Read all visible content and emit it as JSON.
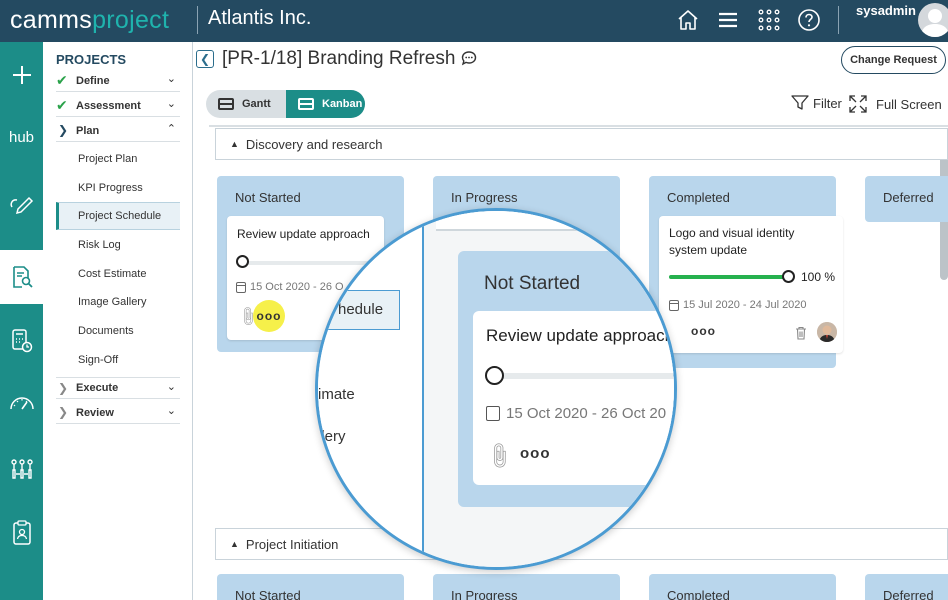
{
  "header": {
    "logo_part1": "camms",
    "logo_part2": "project",
    "company": "Atlantis Inc.",
    "username": "sysadmin",
    "icons": [
      "home-icon",
      "menu-icon",
      "apps-grid-icon",
      "help-icon"
    ]
  },
  "rail": {
    "items": [
      "add-icon",
      "hub",
      "edit-icon",
      "document-search-icon",
      "calculator-icon",
      "gauge-icon",
      "org-chart-icon",
      "clipboard-icon"
    ],
    "hub_label": "hub"
  },
  "sidenav": {
    "heading": "PROJECTS",
    "sections": [
      {
        "label": "Define",
        "status": "done"
      },
      {
        "label": "Assessment",
        "status": "done"
      },
      {
        "label": "Plan",
        "status": "expanded"
      },
      {
        "label": "Execute",
        "status": "collapsed"
      },
      {
        "label": "Review",
        "status": "collapsed"
      }
    ],
    "plan_items": [
      "Project Plan",
      "KPI Progress",
      "Project Schedule",
      "Risk Log",
      "Cost Estimate",
      "Image Gallery",
      "Documents",
      "Sign-Off"
    ],
    "active_item": "Project Schedule"
  },
  "page": {
    "title": "[PR-1/18] Branding Refresh",
    "change_request": "Change Request",
    "view_gantt": "Gantt",
    "view_kanban": "Kanban",
    "filter": "Filter",
    "full_screen": "Full Screen"
  },
  "board": {
    "sections": [
      {
        "name": "Discovery and research",
        "columns": [
          "Not Started",
          "In Progress",
          "Completed",
          "Deferred"
        ]
      },
      {
        "name": "Project Initiation",
        "columns": [
          "Not Started",
          "In Progress",
          "Completed",
          "Deferred"
        ]
      }
    ],
    "cards": {
      "review": {
        "title": "Review update approach",
        "dates": "15 Oct 2020 - 26 Oct 2020",
        "dates_truncated": "15 Oct 2020 - 26 O",
        "progress": 0,
        "more": "ooo"
      },
      "logo": {
        "title": "Logo and visual identity system update",
        "dates": "15 Jul 2020 - 24 Jul 2020",
        "progress": 100,
        "pct_label": "100",
        "pct_sign": "%",
        "more": "ooo"
      }
    }
  },
  "magnifier": {
    "col_title": "Not Started",
    "card_title": "Review update approach",
    "dates": "15 Oct 2020 - 26 Oct 20",
    "more": "ooo",
    "side_fragments": [
      "hedule",
      "imate",
      "llery"
    ]
  },
  "colors": {
    "topbar": "#244a61",
    "rail": "#1c8d88",
    "column": "#b9d6ec",
    "progress": "#26b14e",
    "highlight": "#f6f04a",
    "magnifier_border": "#4b9bd2"
  }
}
